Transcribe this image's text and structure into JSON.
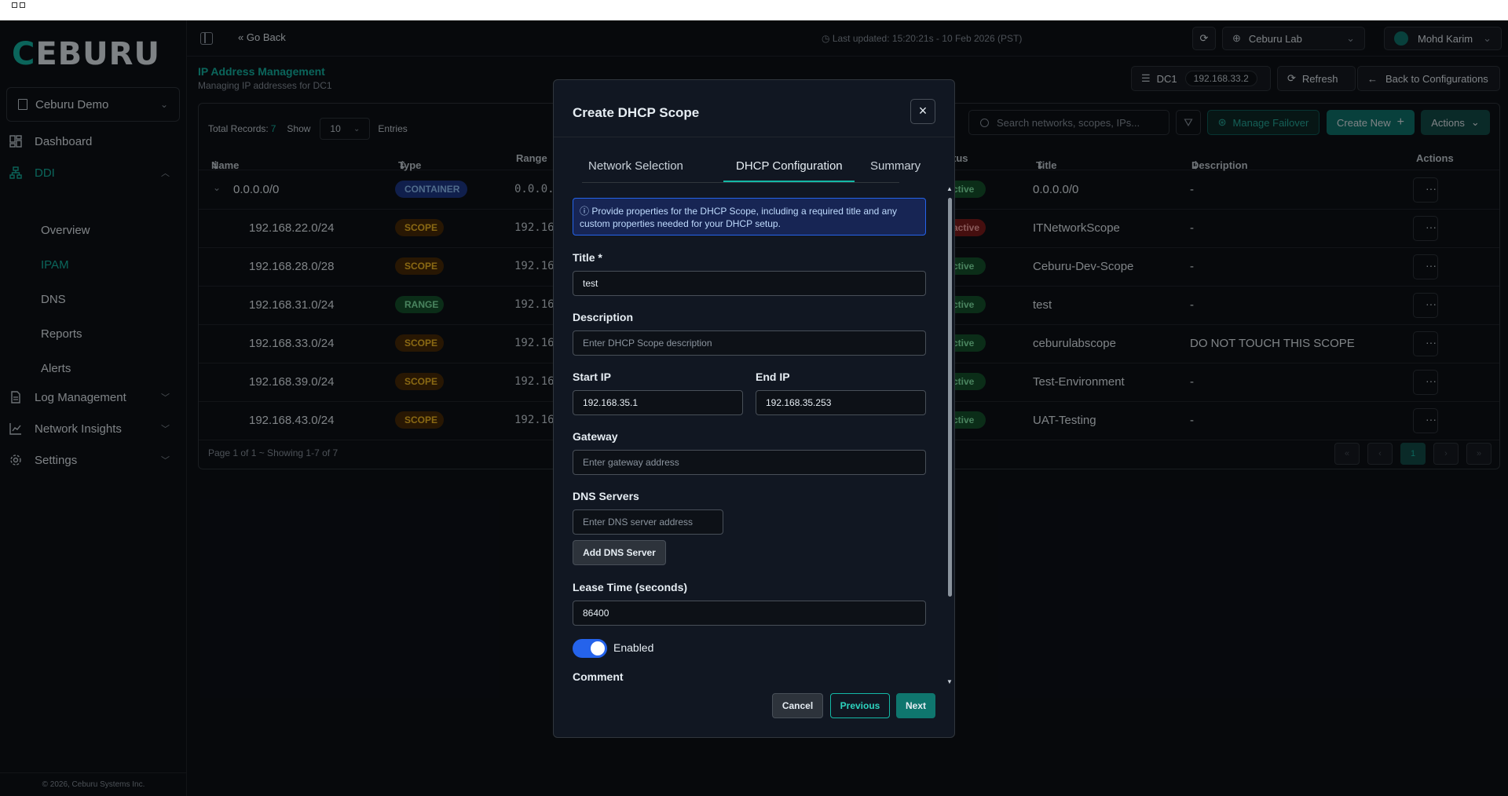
{
  "sidebar": {
    "logo": {
      "first": "C",
      "rest": "EBURU"
    },
    "org": "Ceburu Demo",
    "items": [
      {
        "label": "Dashboard",
        "icon": "dashboard-icon"
      },
      {
        "label": "DDI",
        "icon": "network-tree-icon"
      },
      {
        "label": "Log Management",
        "icon": "document-icon"
      },
      {
        "label": "Network Insights",
        "icon": "chart-icon"
      },
      {
        "label": "Settings",
        "icon": "gear-icon"
      }
    ],
    "ddi_sub": [
      "Overview",
      "IPAM",
      "DNS",
      "Reports",
      "Alerts"
    ],
    "copyright": "© 2026, Ceburu Systems Inc."
  },
  "header": {
    "go_back": "Go Back",
    "last_updated": "Last updated: 15:20:21s - 10 Feb 2026 (PST)",
    "lab": "Ceburu Lab",
    "user": "Mohd Karim"
  },
  "page": {
    "title": "IP Address Management",
    "subtitle": "Managing IP addresses for DC1",
    "dc": "DC1",
    "dc_ip": "192.168.33.2",
    "refresh": "Refresh",
    "back": "Back to Configurations"
  },
  "toolbar": {
    "total_label": "Total Records:",
    "total": "7",
    "show": "Show",
    "show_value": "10",
    "entries": "Entries",
    "search_placeholder": "Search networks, scopes, IPs...",
    "failover": "Manage Failover",
    "create": "Create New",
    "actions": "Actions"
  },
  "table": {
    "headers": {
      "name": "Name",
      "type": "Type",
      "range": "Range",
      "status": "tus",
      "title": "Title",
      "description": "Description",
      "actions": "Actions"
    },
    "rows": [
      {
        "name": "0.0.0.0/0",
        "type": "CONTAINER",
        "range": "0.0.0.",
        "status": "ctive",
        "title": "0.0.0.0/0",
        "desc": "-"
      },
      {
        "name": "192.168.22.0/24",
        "type": "SCOPE",
        "range": "192.16",
        "status": "active",
        "title": "ITNetworkScope",
        "desc": "-"
      },
      {
        "name": "192.168.28.0/28",
        "type": "SCOPE",
        "range": "192.16",
        "status": "ctive",
        "title": "Ceburu-Dev-Scope",
        "desc": "-"
      },
      {
        "name": "192.168.31.0/24",
        "type": "RANGE",
        "range": "192.16",
        "status": "ctive",
        "title": "test",
        "desc": "-"
      },
      {
        "name": "192.168.33.0/24",
        "type": "SCOPE",
        "range": "192.16",
        "status": "ctive",
        "title": "ceburulabscope",
        "desc": "DO NOT TOUCH THIS SCOPE"
      },
      {
        "name": "192.168.39.0/24",
        "type": "SCOPE",
        "range": "192.16",
        "status": "ctive",
        "title": "Test-Environment",
        "desc": "-"
      },
      {
        "name": "192.168.43.0/24",
        "type": "SCOPE",
        "range": "192.16",
        "status": "ctive",
        "title": "UAT-Testing",
        "desc": "-"
      }
    ],
    "pager_text": "Page 1 of 1 ~ Showing 1-7 of 7",
    "page": "1"
  },
  "modal": {
    "title": "Create DHCP Scope",
    "tabs": [
      "Network Selection",
      "DHCP Configuration",
      "Summary"
    ],
    "info": "Provide properties for the DHCP Scope, including a required title and any custom properties needed for your DHCP setup.",
    "title_label": "Title *",
    "title_value": "test",
    "desc_label": "Description",
    "desc_placeholder": "Enter DHCP Scope description",
    "start_label": "Start IP",
    "start_value": "192.168.35.1",
    "end_label": "End IP",
    "end_value": "192.168.35.253",
    "gateway_label": "Gateway",
    "gateway_placeholder": "Enter gateway address",
    "dns_label": "DNS Servers",
    "dns_placeholder": "Enter DNS server address",
    "add_dns": "Add DNS Server",
    "lease_label": "Lease Time (seconds)",
    "lease_value": "86400",
    "enabled_label": "Enabled",
    "enabled": true,
    "comment_label": "Comment",
    "cancel": "Cancel",
    "previous": "Previous",
    "next": "Next"
  }
}
